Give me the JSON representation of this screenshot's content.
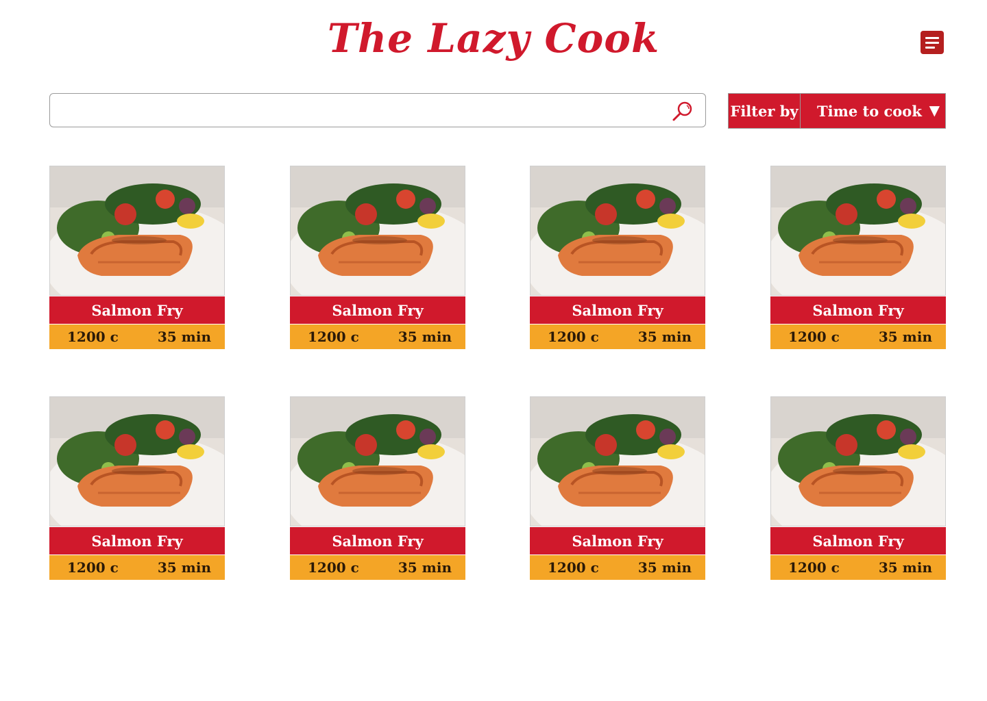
{
  "header": {
    "logo": "The Lazy Cook",
    "brand_color": "#d0192c"
  },
  "search": {
    "value": "",
    "placeholder": "",
    "icon": "search-icon"
  },
  "filter": {
    "label": "Filter by",
    "selected": "Time to cook",
    "arrow": "▼"
  },
  "recipes": [
    {
      "name": "Salmon Fry",
      "calories": "1200 c",
      "time": "35 min"
    },
    {
      "name": "Salmon Fry",
      "calories": "1200 c",
      "time": "35 min"
    },
    {
      "name": "Salmon Fry",
      "calories": "1200 c",
      "time": "35 min"
    },
    {
      "name": "Salmon Fry",
      "calories": "1200 c",
      "time": "35 min"
    },
    {
      "name": "Salmon Fry",
      "calories": "1200 c",
      "time": "35 min"
    },
    {
      "name": "Salmon Fry",
      "calories": "1200 c",
      "time": "35 min"
    },
    {
      "name": "Salmon Fry",
      "calories": "1200 c",
      "time": "35 min"
    },
    {
      "name": "Salmon Fry",
      "calories": "1200 c",
      "time": "35 min"
    }
  ]
}
